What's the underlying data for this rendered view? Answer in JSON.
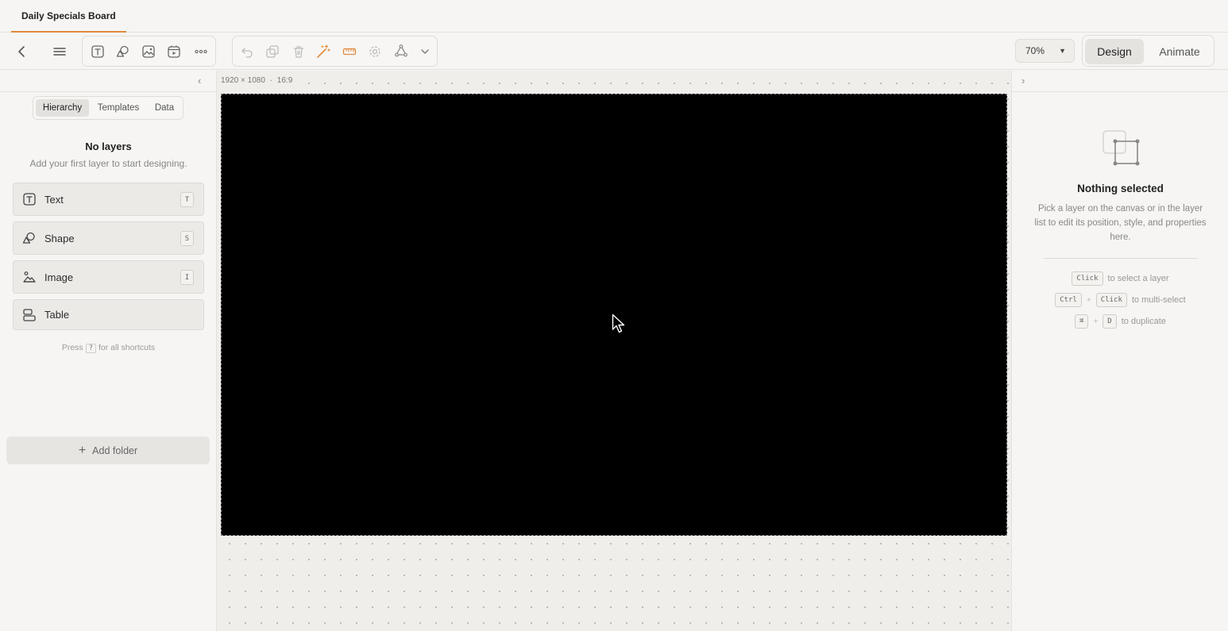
{
  "tab": {
    "title": "Daily Specials Board"
  },
  "toolbar": {
    "zoom": "70%",
    "modes": {
      "design": "Design",
      "animate": "Animate"
    }
  },
  "left_panel": {
    "tabs": [
      "Hierarchy",
      "Templates",
      "Data"
    ],
    "empty_title": "No layers",
    "empty_subtitle": "Add your first layer to start designing.",
    "layer_types": [
      {
        "label": "Text",
        "shortcut": "T"
      },
      {
        "label": "Shape",
        "shortcut": "S"
      },
      {
        "label": "Image",
        "shortcut": "I"
      },
      {
        "label": "Table"
      }
    ],
    "shortcut_hint": {
      "press": "Press",
      "key": "?",
      "rest": "for all shortcuts"
    },
    "add_folder": "Add folder"
  },
  "canvas": {
    "size_label": "1920 × 1080",
    "separator": "·",
    "ratio_label": "16:9",
    "background": "#000000"
  },
  "right_panel": {
    "title": "Nothing selected",
    "description": "Pick a layer on the canvas or in the layer list to edit its position, style, and properties here.",
    "hints": [
      {
        "keys": [
          "Click"
        ],
        "text": "to select a layer"
      },
      {
        "keys": [
          "Ctrl",
          "Click"
        ],
        "text": "to multi-select"
      },
      {
        "keys": [
          "⌘",
          "D"
        ],
        "text": "to duplicate"
      }
    ]
  },
  "colors": {
    "accent": "#e08a3c",
    "artboard": "#000000"
  }
}
